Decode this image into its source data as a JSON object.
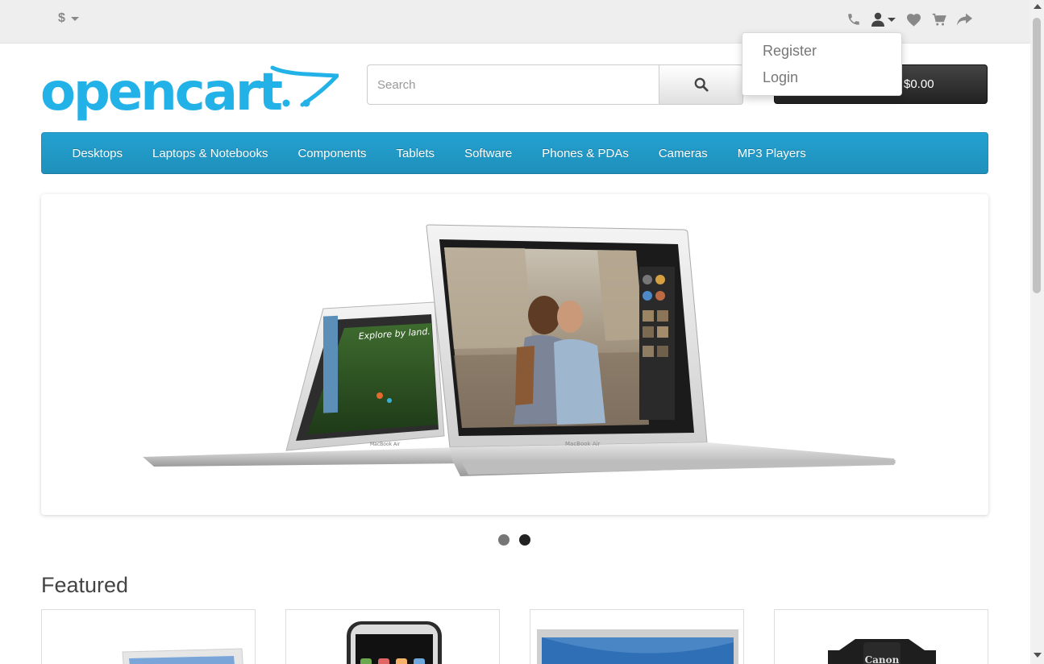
{
  "topbar": {
    "currency_symbol": "$",
    "icons": [
      "phone-icon",
      "user-icon",
      "heart-icon",
      "cart-icon",
      "share-icon"
    ]
  },
  "account_dropdown": {
    "register": "Register",
    "login": "Login"
  },
  "header": {
    "logo_text": "opencart",
    "search_placeholder": "Search",
    "cart_total": "$0.00"
  },
  "menu": {
    "items": [
      "Desktops",
      "Laptops & Notebooks",
      "Components",
      "Tablets",
      "Software",
      "Phones & PDAs",
      "Cameras",
      "MP3 Players"
    ]
  },
  "slideshow": {
    "screen_text": "Explore by land.",
    "brand_label": "MacBook Air",
    "slide_count": 2,
    "active_slide": 2
  },
  "featured": {
    "title": "Featured",
    "camera_brand": "Canon"
  },
  "colors": {
    "logo": "#23b2e8",
    "menu": "#229ac8",
    "cart_button": "#333333",
    "topbar": "#eeeeee"
  }
}
